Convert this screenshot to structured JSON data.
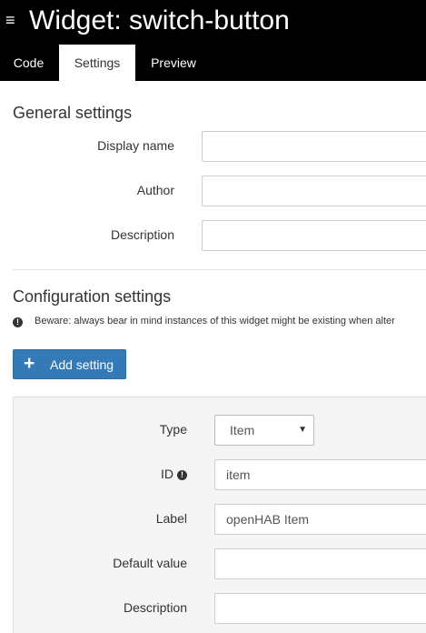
{
  "header": {
    "menu_glyph": "≡",
    "title": "Widget: switch-button",
    "tabs": [
      {
        "label": "Code",
        "active": false
      },
      {
        "label": "Settings",
        "active": true
      },
      {
        "label": "Preview",
        "active": false
      }
    ]
  },
  "general": {
    "title": "General settings",
    "display_name_label": "Display name",
    "display_name_value": "",
    "author_label": "Author",
    "author_value": "",
    "description_label": "Description",
    "description_value": ""
  },
  "config": {
    "title": "Configuration settings",
    "warning_text": "Beware: always bear in mind instances of this widget might be existing when alter",
    "add_button_icon": "+",
    "add_button_label": "Add setting",
    "setting": {
      "type_label": "Type",
      "type_value": "Item",
      "type_caret": "▼",
      "id_label": "ID",
      "id_value": "item",
      "label_label": "Label",
      "label_value": "openHAB Item",
      "default_label": "Default value",
      "default_value": "",
      "description_label": "Description",
      "description_value": ""
    }
  },
  "icons": {
    "menu": "hamburger-icon",
    "warning": "exclamation-circle-icon",
    "info": "info-circle-icon",
    "add": "plus-icon",
    "caret": "caret-down-icon"
  },
  "colors": {
    "header_bg": "#000000",
    "primary_button": "#337ab7",
    "panel_bg": "#f5f5f5"
  }
}
